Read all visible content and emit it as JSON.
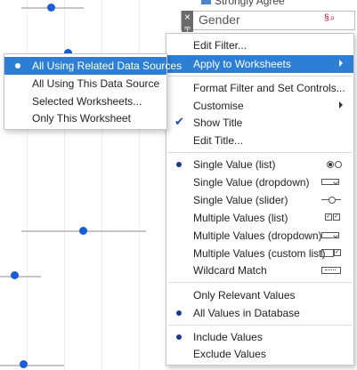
{
  "legend": {
    "item_label": "Strongly Agree",
    "swatch_color": "#4b84c8"
  },
  "filter_card": {
    "title": "Gender",
    "close_glyph": "×",
    "pin_glyph": "╤",
    "search_icons": "§⌕"
  },
  "context_menu": {
    "edit_filter": "Edit Filter...",
    "apply_to_worksheets": "Apply to Worksheets",
    "format_filter": "Format Filter and Set Controls...",
    "customise": "Customise",
    "show_title": "Show Title",
    "edit_title": "Edit Title...",
    "single_value_list": "Single Value (list)",
    "single_value_dropdown": "Single Value (dropdown)",
    "single_value_slider": "Single Value (slider)",
    "multiple_values_list": "Multiple Values (list)",
    "multiple_values_dropdown": "Multiple Values (dropdown)",
    "multiple_values_custom_list": "Multiple Values (custom list)",
    "wildcard_match": "Wildcard Match",
    "only_relevant_values": "Only Relevant Values",
    "all_values_in_database": "All Values in Database",
    "include_values": "Include Values",
    "exclude_values": "Exclude Values",
    "check_glyph": "✔"
  },
  "submenu": {
    "all_related": "All Using Related Data Sources",
    "all_this_source": "All Using This Data Source",
    "selected_worksheets": "Selected Worksheets...",
    "only_this_worksheet": "Only This Worksheet"
  },
  "colors": {
    "highlight": "#2d7fd6",
    "dot": "#1a5bd6"
  }
}
